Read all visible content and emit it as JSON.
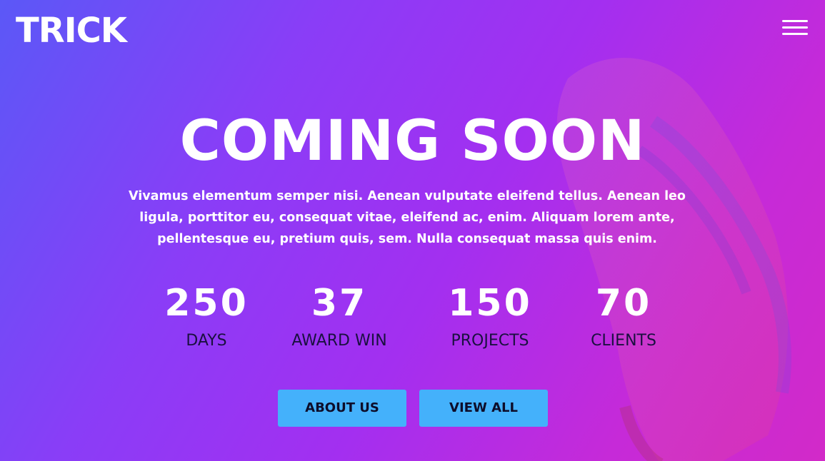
{
  "header": {
    "logo": "TRICK",
    "menu_icon": "hamburger-menu-icon"
  },
  "hero": {
    "title": "COMING SOON",
    "description": "Vivamus elementum semper nisi. Aenean vulputate eleifend tellus. Aenean leo ligula, porttitor eu, consequat vitae, eleifend ac, enim. Aliquam lorem ante, pellentesque eu, pretium quis, sem. Nulla consequat massa quis enim."
  },
  "stats": [
    {
      "value": "250",
      "label": "DAYS"
    },
    {
      "value": "37",
      "label": "AWARD WIN"
    },
    {
      "value": "150",
      "label": "PROJECTS"
    },
    {
      "value": "70",
      "label": "CLIENTS"
    }
  ],
  "buttons": {
    "about": "ABOUT US",
    "view_all": "VIEW ALL"
  },
  "colors": {
    "gradient_start": "#5b58f7",
    "gradient_end": "#d22ac8",
    "button": "#44b1fb"
  }
}
